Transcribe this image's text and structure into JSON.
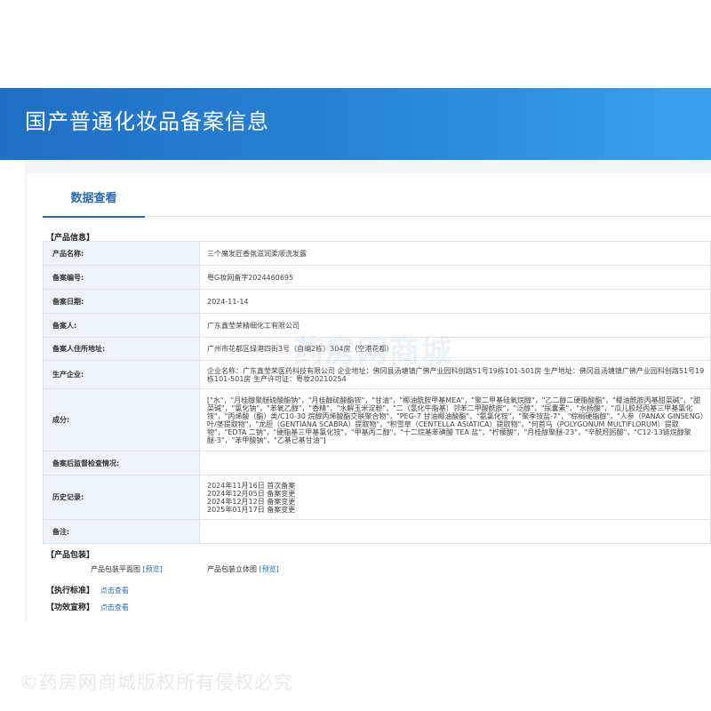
{
  "header": {
    "title": "国产普通化妆品备案信息"
  },
  "tabs": [
    {
      "label": "数据查看"
    }
  ],
  "product_section_title": "【产品信息】",
  "rows": [
    {
      "label": "产品名称:",
      "value": "三个魔发匠香氛滋润柔顺洗发露"
    },
    {
      "label": "备案编号:",
      "value": "粤G妆网备字2024460695"
    },
    {
      "label": "备案日期:",
      "value": "2024-11-14"
    },
    {
      "label": "备案人:",
      "value": "广东鑫莹荣精细化工有限公司"
    },
    {
      "label": "备案人住所地址:",
      "value": "广州市花都区绿港四街3号（自编2栋）304房（空港花都）"
    },
    {
      "label": "生产企业:",
      "value": "企业名称：广东鑫莹荣医药科技有限公司 企业地址：佛冈县汤塘镇广佛产业园科创路51号19栋101-501房 生产地址：佛冈县汤塘镇广佛产业园科创路51号19栋101-501房 生产许可证：粤妆20210254"
    },
    {
      "label": "成分:",
      "value": "[\"水\"，\"月桂醇聚醚硫酸酯钠\"，\"月桂醇硫酸酯铵\"，\"甘油\"，\"椰油酰胺甲基MEA\"，\"聚二甲基硅氧烷醇\"，\"乙二醇二硬脂酸酯\"，\"椰油酰胺丙基甜菜碱\"，\"甜菜碱\"，\"氯化钠\"，\"苯氧乙醇\"，\"香精\"，\"水解玉米淀粉\"，\"二（氢化牛脂基）邻苯二甲酸酰胺\"，\"泛醇\"，\"尿囊素\"，\"水杨酸\"，\"瓜儿胶羟丙基三甲基氯化铵\"，\"丙烯酸（酯）类/C10-30 烷醇丙烯酸酯交联聚合物\"，\"PEG-7 甘油椰油酸酯\"，\"氨氯化铵\"，\"聚季铵盐-7\"，\"棕榈硬脂醇\"，\"人参（PANAX GINSENG）叶/茎提取物\"，\"龙胆（GENTIANA SCABRA）提取物\"，\"积雪草（CENTELLA ASIATICA）提取物\"，\"何首乌（POLYGONUM MULTIFLORUM）提取物\"，\"EDTA 二钠\"，\"硬脂基三甲基氯化铵\"，\"甲基丙二醇\"，\"十二烷基苯磺酸 TEA 盐\"，\"柠檬酸\"，\"月桂醇聚醚-23\"，\"辛酰羟肟酸\"，\"C12-13链烷醇聚醚-3\"，\"苯甲酸钠\"，\"乙基己基甘油\"]"
    },
    {
      "label": "备案后监督检查情况:",
      "value": ""
    },
    {
      "label": "历史记录:",
      "lines": [
        "2024年11月16日 首次备案",
        "2024年12月05日 备案变更",
        "2024年12月12日 备案变更",
        "2025年01月17日 备案变更"
      ]
    },
    {
      "label": "备注:",
      "value": ""
    }
  ],
  "packaging": {
    "title": "【产品包装】",
    "flat_label": "产品包装平面图",
    "flat_link": "[预览]",
    "solid_label": "产品包装立体图",
    "solid_link": "[预览]"
  },
  "standard": {
    "label": "【执行标准】",
    "link": "点击查看"
  },
  "claims": {
    "label": "【功效宣称】",
    "link": "点击查看"
  },
  "watermarks": {
    "center": "药房网商城",
    "bottom": "©药房网商城版权所有侵权必究"
  }
}
